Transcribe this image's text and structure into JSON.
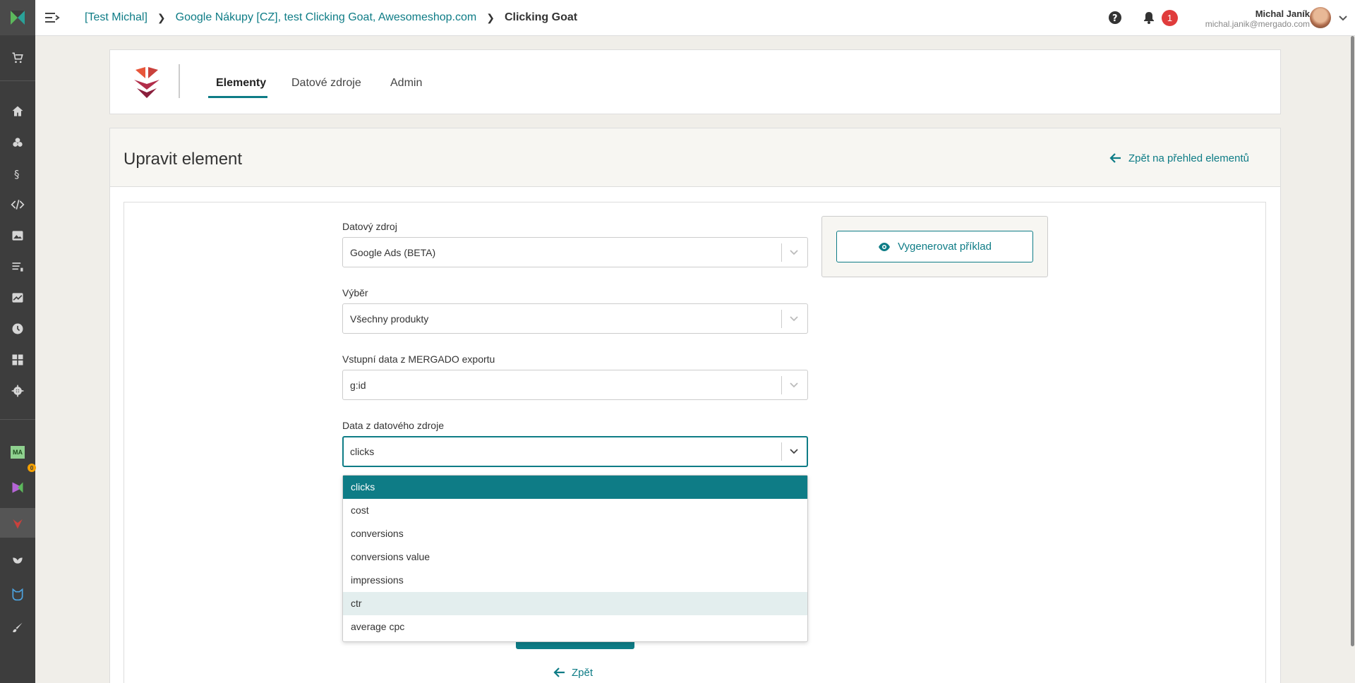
{
  "colors": {
    "accent": "#0e7c86",
    "sidebar": "#3d3d3d",
    "badge_red": "#e03c3c",
    "badge_orange": "#f4a000"
  },
  "sidebar": {
    "icons": [
      "mergado-logo-icon",
      "cart-icon",
      "home-icon",
      "layers-icon",
      "paragraph-icon",
      "code-icon",
      "image-icon",
      "list-icon",
      "chart-icon",
      "clock-icon",
      "grid-icon",
      "gear-icon",
      "ma-app-icon",
      "mergado-app-icon",
      "goat-app-icon",
      "plant-app-icon",
      "cat-app-icon",
      "brush-app-icon"
    ],
    "ma_label": "MA",
    "badge": "0"
  },
  "topbar": {
    "breadcrumb": [
      "[Test Michal]",
      "Google Nákupy [CZ], test Clicking Goat, Awesomeshop.com",
      "Clicking Goat"
    ],
    "notifications": "1",
    "user_name": "Michal Janík",
    "user_email": "michal.janik@mergado.com"
  },
  "app": {
    "tabs": [
      "Elementy",
      "Datové zdroje",
      "Admin"
    ]
  },
  "page": {
    "title": "Upravit element",
    "back_to_list": "Zpět na přehled elementů",
    "back": "Zpět"
  },
  "form": {
    "fields": [
      {
        "label": "Datový zdroj",
        "value": "Google Ads (BETA)"
      },
      {
        "label": "Výběr",
        "value": "Všechny produkty"
      },
      {
        "label": "Vstupní data z MERGADO exportu",
        "value": "g:id"
      },
      {
        "label": "Data z datového zdroje",
        "value": "clicks"
      }
    ],
    "generate_button": "Vygenerovat příklad"
  },
  "dropdown": {
    "options": [
      "clicks",
      "cost",
      "conversions",
      "conversions value",
      "impressions",
      "ctr",
      "average cpc"
    ],
    "selected": "clicks",
    "hovered": "ctr"
  }
}
